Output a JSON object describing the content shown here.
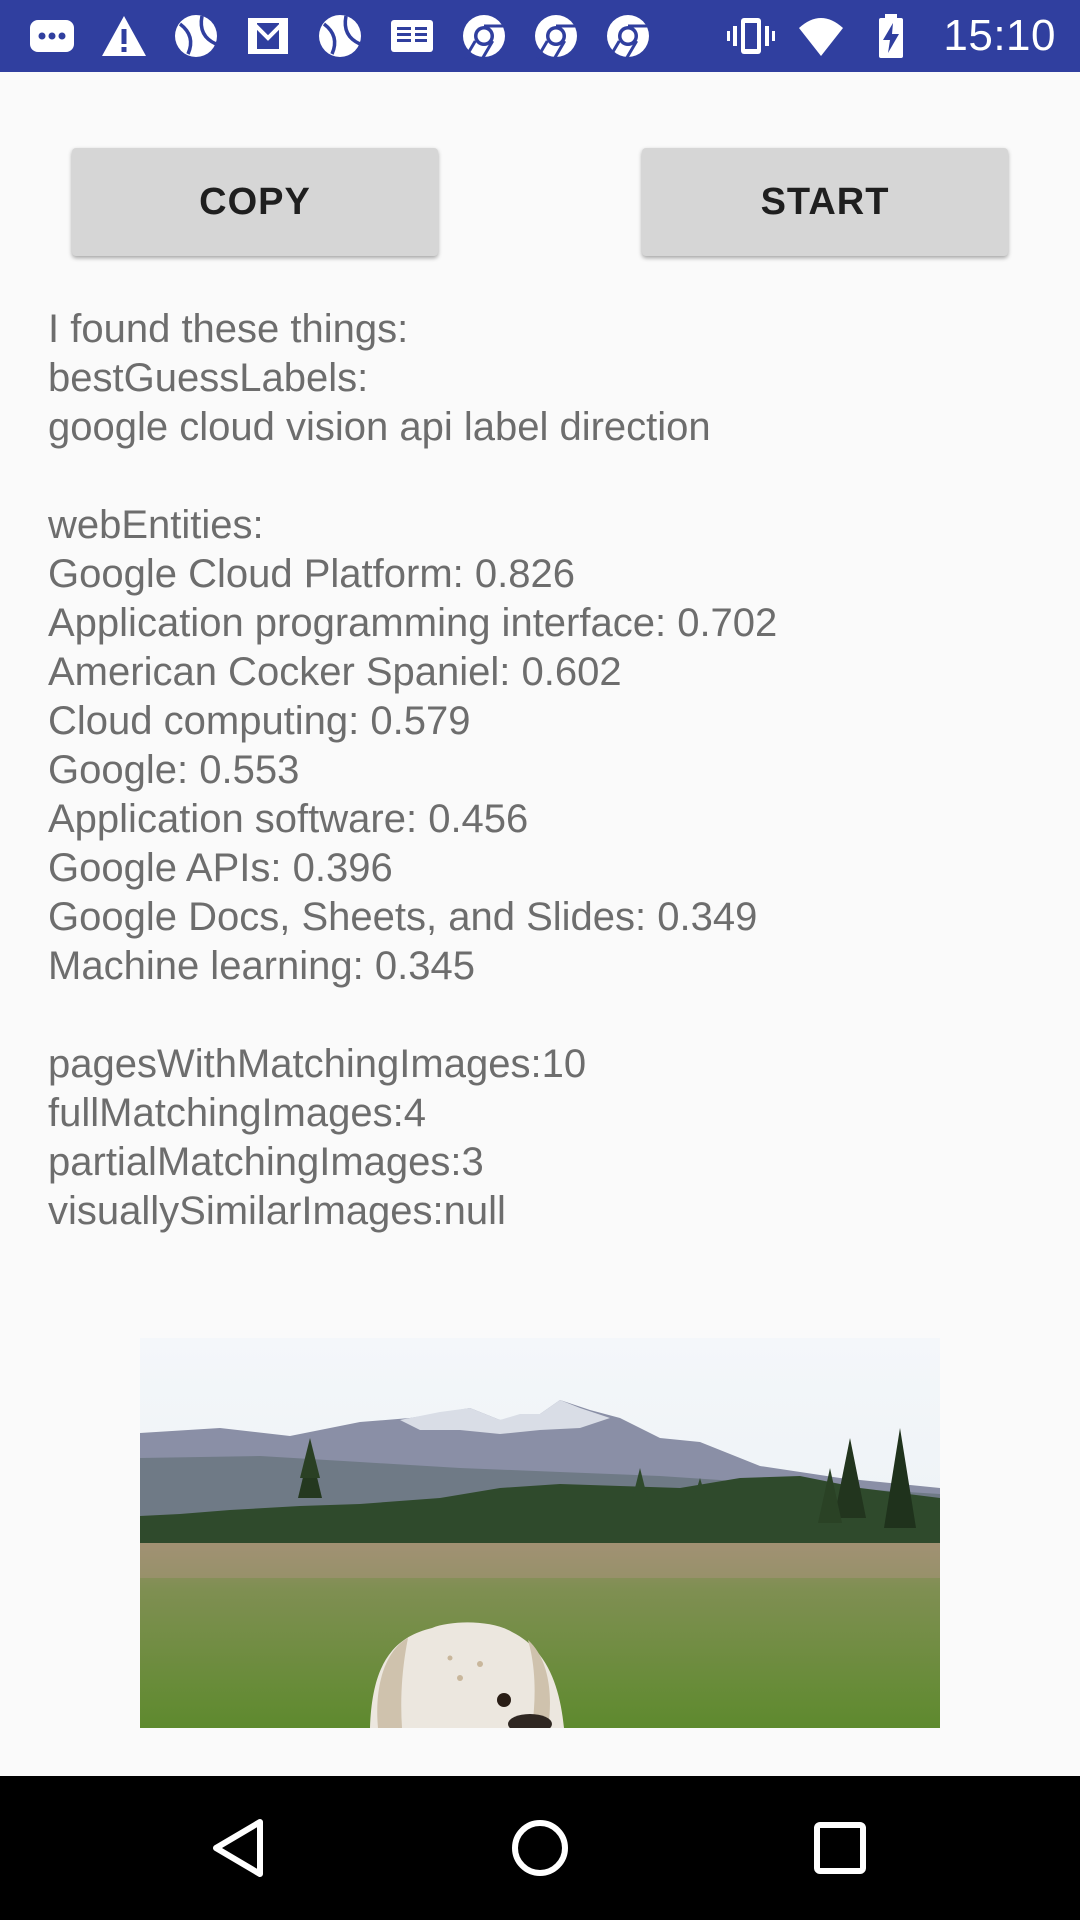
{
  "status_bar": {
    "time": "15:10",
    "background_color": "#303f9f",
    "left_icons": [
      "messages-icon",
      "warning-icon",
      "ball-icon",
      "gmail-icon",
      "ball-icon",
      "google-news-icon",
      "chrome-icon",
      "chrome-icon",
      "chrome-icon"
    ],
    "right_icons": [
      "vibrate-icon",
      "wifi-icon",
      "battery-charging-icon"
    ]
  },
  "buttons": {
    "copy_label": "COPY",
    "start_label": "START",
    "color": "#d6d6d6"
  },
  "result": {
    "lines": [
      "I found these things:",
      "bestGuessLabels:",
      "google cloud vision api label direction",
      "",
      "webEntities:",
      "Google Cloud Platform: 0.826",
      "Application programming interface: 0.702",
      "American Cocker Spaniel: 0.602",
      "Cloud computing: 0.579",
      "Google: 0.553",
      "Application software: 0.456",
      "Google APIs: 0.396",
      "Google Docs, Sheets, and Slides: 0.349",
      "Machine learning: 0.345",
      "",
      "pagesWithMatchingImages:10",
      "fullMatchingImages:4",
      "partialMatchingImages:3",
      "visuallySimilarImages:null"
    ],
    "text_color": "#6d6d6d"
  },
  "photo": {
    "subject": "dog-in-meadow-photo"
  },
  "nav_bar": {
    "icons": [
      "back-icon",
      "home-icon",
      "recents-icon"
    ]
  }
}
